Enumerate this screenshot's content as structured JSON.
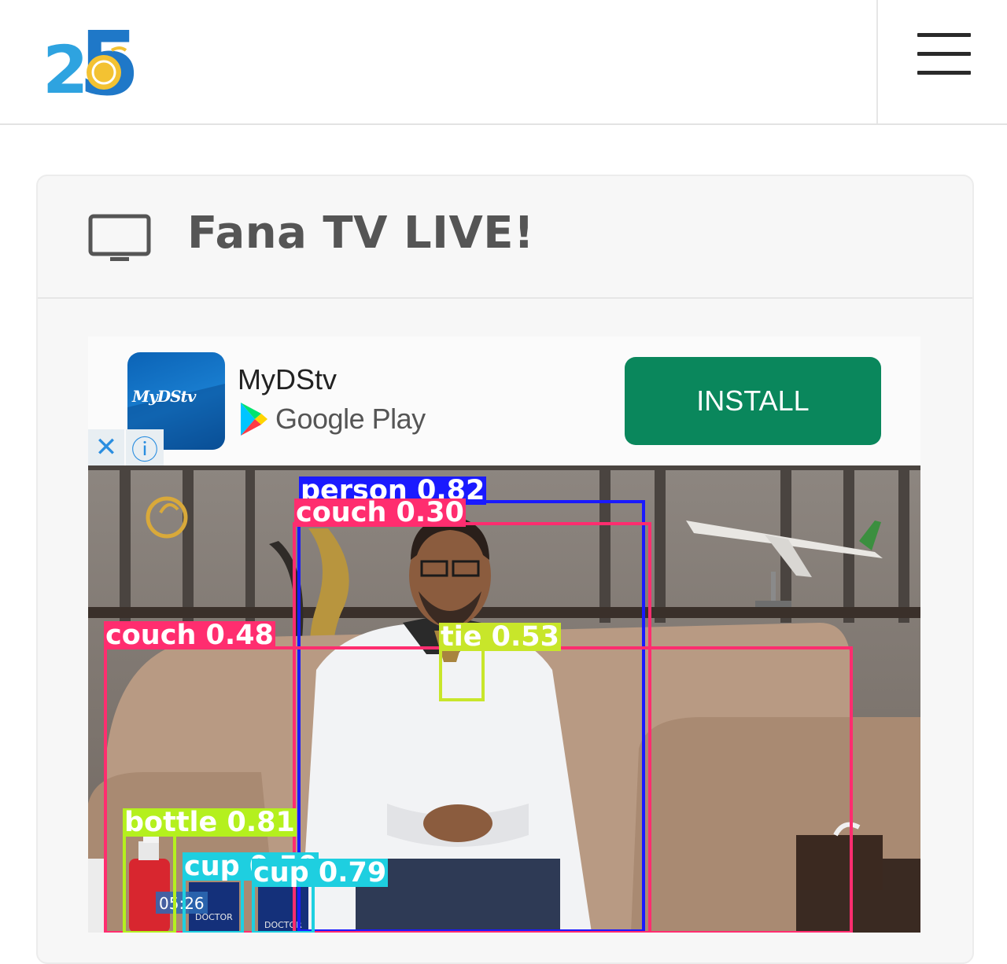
{
  "header": {
    "logo_icon": "anniversary-25-logo",
    "menu_icon": "hamburger-menu-icon"
  },
  "card": {
    "icon": "tv-icon",
    "title": "Fana TV LIVE!"
  },
  "ad": {
    "app_name": "MyDStv",
    "app_icon_text": "MyDStv",
    "store": "Google Play",
    "install_label": "INSTALL",
    "close_glyph": "✕",
    "info_glyph": "ⓘ",
    "install_color": "#0a875c"
  },
  "video": {
    "timestamp": "05:26",
    "cup_text": "DOCTOR"
  },
  "detections": [
    {
      "label": "person 0.82",
      "color": "#1a1aff"
    },
    {
      "label": "couch 0.30",
      "color": "#ff2d6f"
    },
    {
      "label": "couch 0.48",
      "color": "#ff2d6f"
    },
    {
      "label": "tie 0.53",
      "color": "#c8e62a"
    },
    {
      "label": "bottle 0.81",
      "color": "#b4f01e"
    },
    {
      "label": "cup 0.50",
      "color": "#1ecfe0"
    },
    {
      "label": "cup 0.79",
      "color": "#1ecfe0"
    }
  ]
}
